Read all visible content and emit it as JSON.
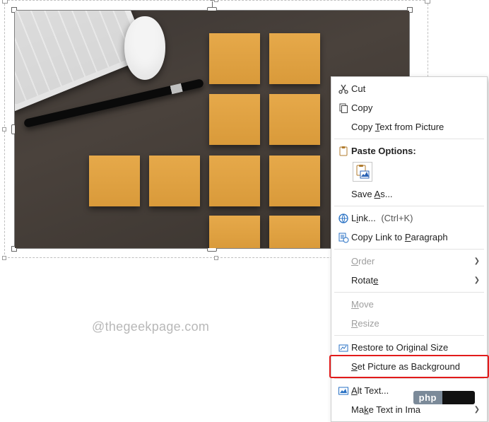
{
  "watermark": "@thegeekpage.com",
  "menu": {
    "cut": "Cut",
    "copy": "Copy",
    "copy_text": "Copy Text from Picture",
    "paste_header": "Paste Options:",
    "save_as": "Save As...",
    "link": "Link...",
    "link_shortcut": "(Ctrl+K)",
    "copy_link_para": "Copy Link to Paragraph",
    "order": "Order",
    "rotate": "Rotate",
    "move": "Move",
    "resize": "Resize",
    "restore": "Restore to Original Size",
    "set_bg": "Set Picture as Background",
    "alt_text": "Alt Text...",
    "make_text": "Make Text in Ima"
  },
  "badge": {
    "label": "php"
  }
}
